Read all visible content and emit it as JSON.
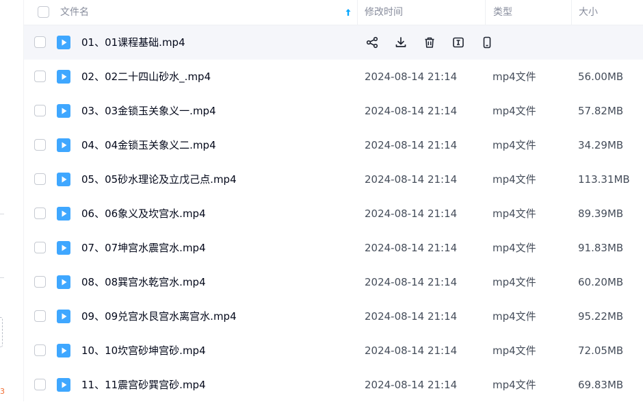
{
  "colors": {
    "accent": "#06a7ff",
    "file_icon": "#3fa7ff",
    "hover_row": "#f5f6fa"
  },
  "header": {
    "name": "文件名",
    "modified": "修改时间",
    "type": "类型",
    "size": "大小",
    "sort_icon": "arrow-up-icon"
  },
  "hover_actions": [
    "share-icon",
    "download-icon",
    "delete-icon",
    "rename-icon",
    "phone-icon"
  ],
  "left_badge": "3",
  "rows": [
    {
      "name": "01、01课程基础.mp4",
      "time": "",
      "type": "",
      "size": ""
    },
    {
      "name": "02、02二十四山砂水_.mp4",
      "time": "2024-08-14 21:14",
      "type": "mp4文件",
      "size": "56.00MB"
    },
    {
      "name": "03、03金锁玉关象义一.mp4",
      "time": "2024-08-14 21:14",
      "type": "mp4文件",
      "size": "57.82MB"
    },
    {
      "name": "04、04金锁玉关象义二.mp4",
      "time": "2024-08-14 21:14",
      "type": "mp4文件",
      "size": "34.29MB"
    },
    {
      "name": "05、05砂水理论及立戊己点.mp4",
      "time": "2024-08-14 21:14",
      "type": "mp4文件",
      "size": "113.31MB"
    },
    {
      "name": "06、06象义及坎宫水.mp4",
      "time": "2024-08-14 21:14",
      "type": "mp4文件",
      "size": "89.39MB"
    },
    {
      "name": "07、07坤宫水震宫水.mp4",
      "time": "2024-08-14 21:14",
      "type": "mp4文件",
      "size": "91.83MB"
    },
    {
      "name": "08、08巽宫水乾宫水.mp4",
      "time": "2024-08-14 21:14",
      "type": "mp4文件",
      "size": "60.20MB"
    },
    {
      "name": "09、09兑宫水艮宫水离宫水.mp4",
      "time": "2024-08-14 21:14",
      "type": "mp4文件",
      "size": "95.22MB"
    },
    {
      "name": "10、10坎宫砂坤宫砂.mp4",
      "time": "2024-08-14 21:14",
      "type": "mp4文件",
      "size": "72.05MB"
    },
    {
      "name": "11、11震宫砂巽宫砂.mp4",
      "time": "2024-08-14 21:14",
      "type": "mp4文件",
      "size": "69.83MB"
    }
  ]
}
